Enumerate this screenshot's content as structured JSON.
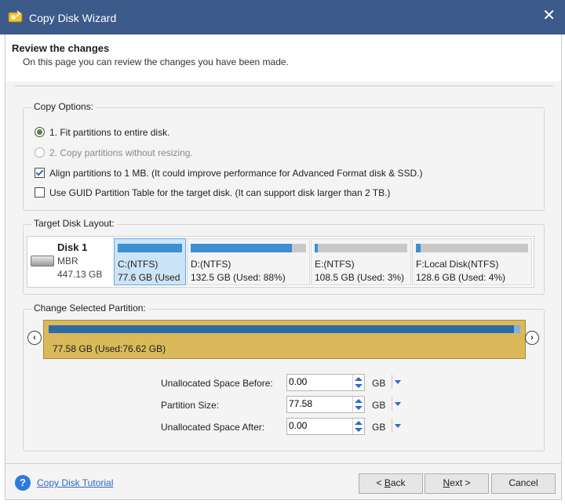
{
  "window": {
    "title": "Copy Disk Wizard",
    "close_glyph": "✕"
  },
  "header": {
    "title": "Review the changes",
    "subtitle": "On this page you can review the changes you have been made."
  },
  "copy_options": {
    "legend": "Copy Options:",
    "option1": "1. Fit partitions to entire disk.",
    "option2": "2. Copy partitions without resizing.",
    "option3": "Align partitions to 1 MB.  (It could improve performance for Advanced Format disk & SSD.)",
    "option4": "Use GUID Partition Table for the target disk. (It can support disk larger than 2 TB.)",
    "selected_option": 1,
    "align_checked": true,
    "gpt_checked": false
  },
  "target_layout": {
    "legend": "Target Disk Layout:",
    "disk": {
      "name": "Disk 1",
      "type": "MBR",
      "size": "447.13 GB"
    },
    "partitions": [
      {
        "name": "C:(NTFS)",
        "used": "77.6 GB (Used",
        "usage": 1.0,
        "selected": true
      },
      {
        "name": "D:(NTFS)",
        "used": "132.5 GB (Used: 88%)",
        "usage": 0.88,
        "selected": false
      },
      {
        "name": "E:(NTFS)",
        "used": "108.5 GB (Used: 3%)",
        "usage": 0.03,
        "selected": false
      },
      {
        "name": "F:Local Disk(NTFS)",
        "used": "128.6 GB (Used: 4%)",
        "usage": 0.04,
        "selected": false
      }
    ]
  },
  "change_partition": {
    "legend": "Change Selected Partition:",
    "bar_text": "77.58 GB (Used:76.62 GB)",
    "left_arrow": "‹",
    "right_arrow": "›",
    "fields": {
      "before": {
        "label": "Unallocated Space Before:",
        "value": "0.00",
        "unit": "GB"
      },
      "size": {
        "label": "Partition Size:",
        "value": "77.58",
        "unit": "GB"
      },
      "after": {
        "label": "Unallocated Space After:",
        "value": "0.00",
        "unit": "GB"
      }
    }
  },
  "footer": {
    "help_glyph": "?",
    "help_link": "Copy Disk Tutorial",
    "back_prefix": "< ",
    "back_key": "B",
    "back_rest": "ack",
    "next_key": "N",
    "next_rest": "ext >",
    "cancel": "Cancel"
  },
  "colors": {
    "titlebar": "#3c5a8a",
    "selected_partition": "#cce4f7",
    "usage_fill": "#3d8fd1",
    "resize_bar": "#d9b95a"
  }
}
